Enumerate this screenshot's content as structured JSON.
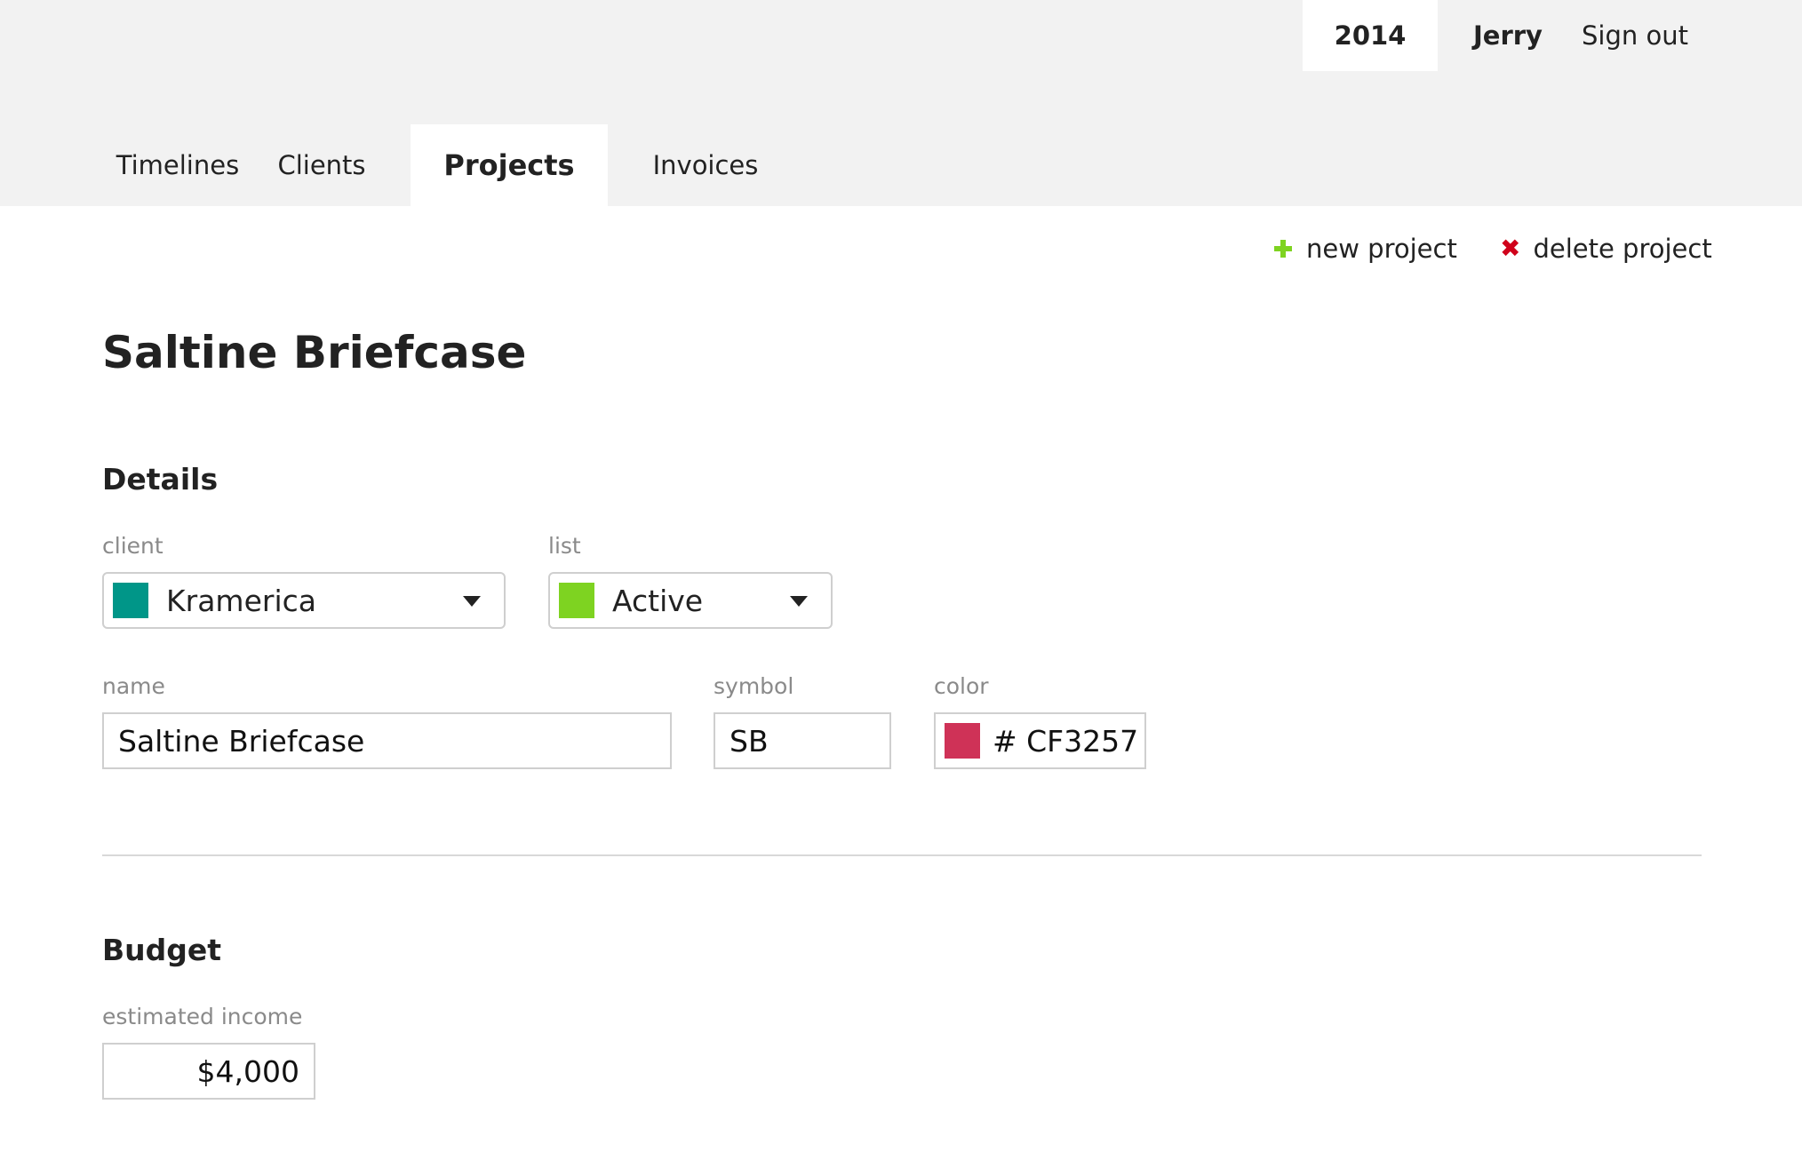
{
  "header": {
    "year": "2014",
    "user": "Jerry",
    "sign_out": "Sign out"
  },
  "nav": {
    "tabs": [
      {
        "label": "Timelines"
      },
      {
        "label": "Clients"
      },
      {
        "label": "Projects",
        "active": true
      },
      {
        "label": "Invoices"
      }
    ]
  },
  "actions": {
    "new_project": "new project",
    "delete_project": "delete project"
  },
  "project": {
    "title": "Saltine Briefcase",
    "details": {
      "section_title": "Details",
      "client_label": "client",
      "client_value": "Kramerica",
      "client_color": "#009688",
      "list_label": "list",
      "list_value": "Active",
      "list_color": "#7ed321",
      "name_label": "name",
      "name_value": "Saltine Briefcase",
      "symbol_label": "symbol",
      "symbol_value": "SB",
      "color_label": "color",
      "color_value": "# CF3257",
      "color_hex": "#CF3257"
    },
    "budget": {
      "section_title": "Budget",
      "income_label": "estimated income",
      "income_value": "$4,000"
    }
  }
}
